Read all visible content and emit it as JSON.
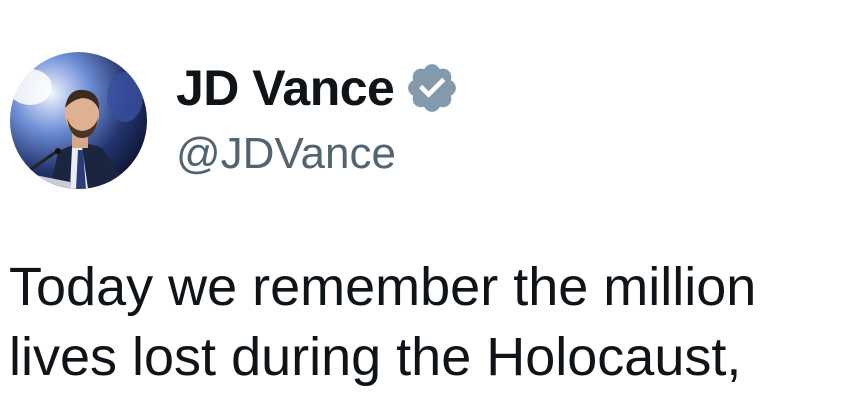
{
  "author": {
    "display_name": "JD Vance",
    "handle": "@JDVance",
    "verified_icon": "verified-badge-icon",
    "badge_color": "#829aab"
  },
  "tweet": {
    "lines": [
      "Today we remember the million",
      "lives lost during the Holocaust,"
    ]
  },
  "colors": {
    "text": "#0f1419",
    "secondary_text": "#536471",
    "background": "#ffffff"
  }
}
